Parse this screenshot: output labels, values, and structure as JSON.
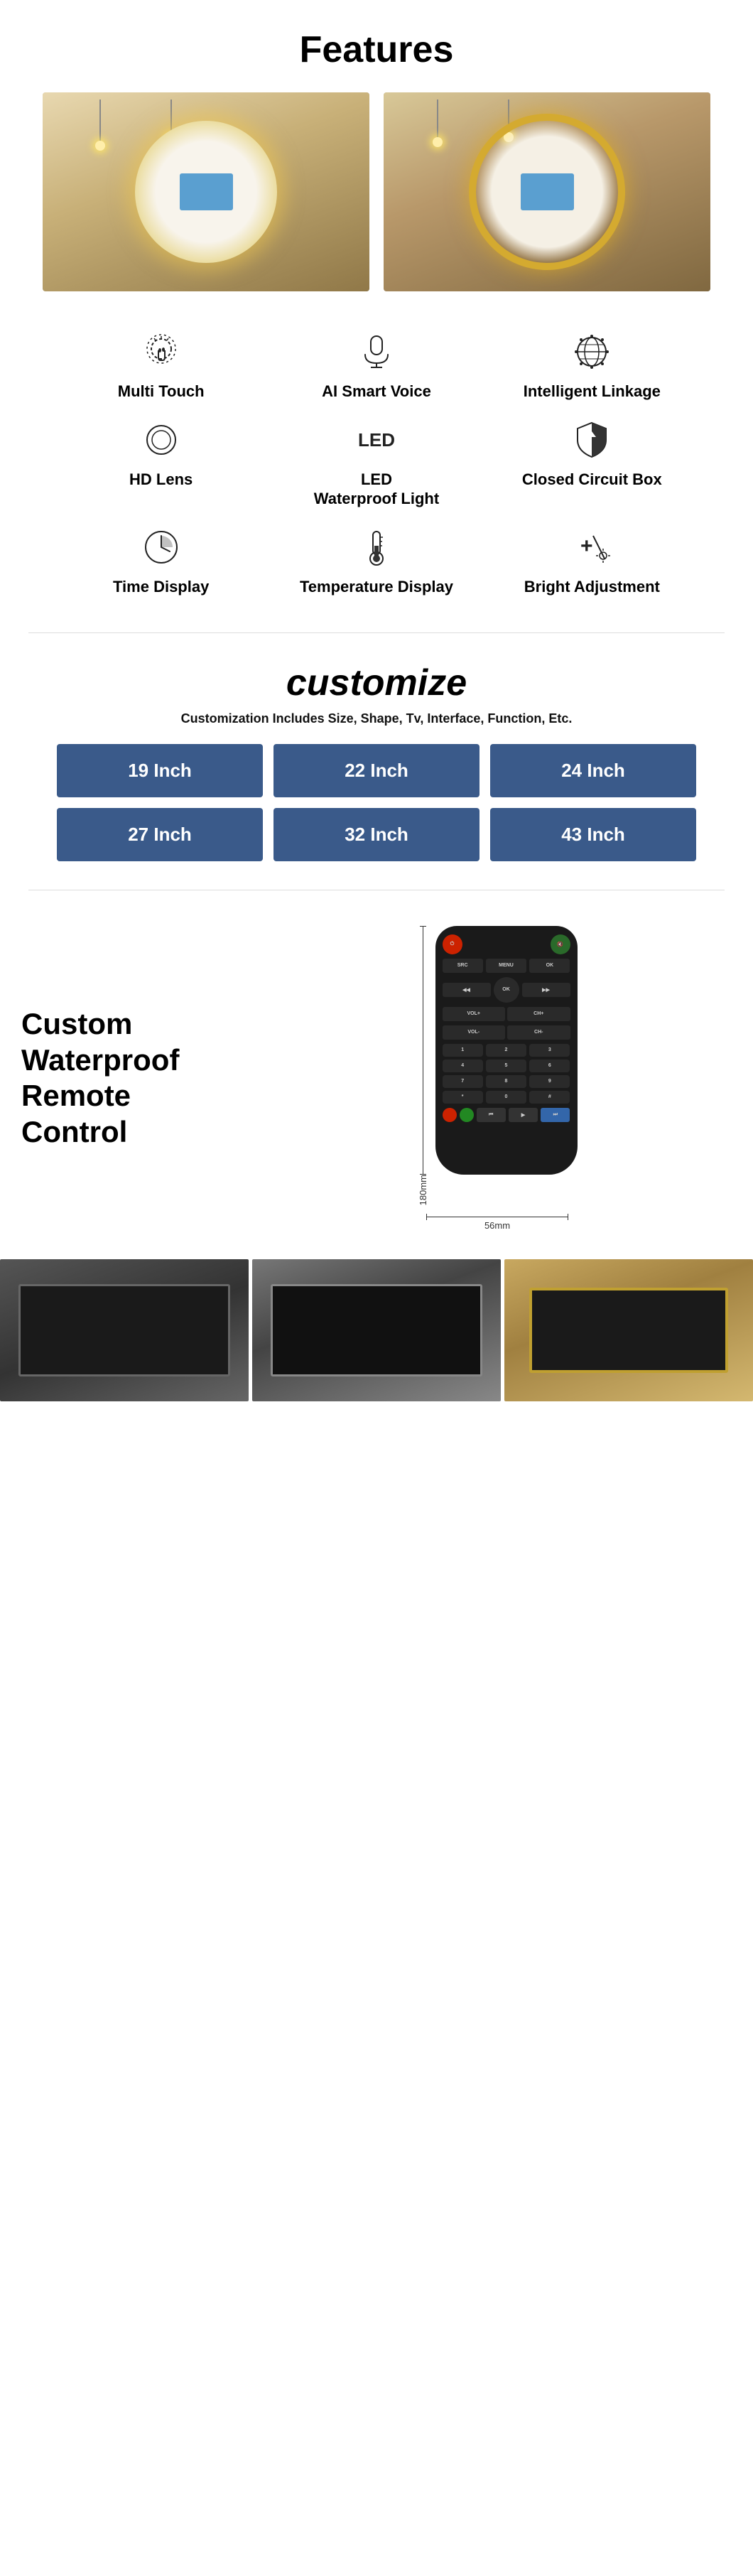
{
  "page": {
    "features": {
      "title": "Features",
      "mirror_images": [
        {
          "id": "mirror-left",
          "alt": "Round mirror with warm white LED - left"
        },
        {
          "id": "mirror-right",
          "alt": "Round mirror with golden LED ring - right"
        }
      ],
      "feature_items": [
        {
          "id": "multi-touch",
          "icon": "touch",
          "label": "Multi Touch"
        },
        {
          "id": "ai-smart-voice",
          "icon": "microphone",
          "label": "AI Smart Voice"
        },
        {
          "id": "intelligent-linkage",
          "icon": "globe-gear",
          "label": "Intelligent Linkage"
        },
        {
          "id": "hd-lens",
          "icon": "circle-lens",
          "label": "HD Lens"
        },
        {
          "id": "led-waterproof",
          "icon": "led-text",
          "label": "LED\nWaterproof Light"
        },
        {
          "id": "closed-circuit",
          "icon": "shield",
          "label": "Closed Circuit Box"
        },
        {
          "id": "time-display",
          "icon": "clock",
          "label": "Time Display"
        },
        {
          "id": "temperature-display",
          "icon": "thermometer",
          "label": "Temperature Display"
        },
        {
          "id": "bright-adjustment",
          "icon": "brightness",
          "label": "Bright Adjustment"
        }
      ]
    },
    "customize": {
      "title": "customize",
      "subtitle": "Customization Includes Size, Shape, Tv, Interface, Function, Etc.",
      "sizes": [
        {
          "label": "19 Inch"
        },
        {
          "label": "22 Inch"
        },
        {
          "label": "24 Inch"
        },
        {
          "label": "27 Inch"
        },
        {
          "label": "32 Inch"
        },
        {
          "label": "43 Inch"
        }
      ]
    },
    "remote": {
      "label": "Custom Waterproof Remote Control",
      "height_dim": "180mm",
      "width_dim": "56mm"
    }
  }
}
